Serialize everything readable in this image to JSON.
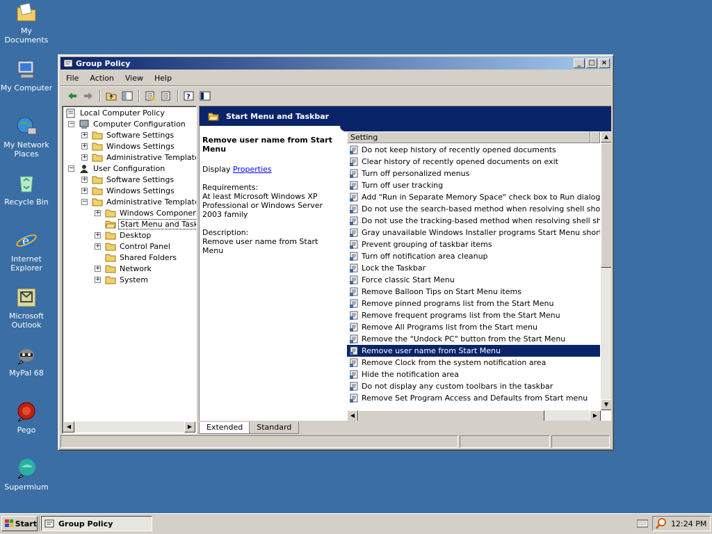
{
  "desktop": {
    "icons": [
      {
        "label": "My Documents"
      },
      {
        "label": "My Computer"
      },
      {
        "label": "My Network Places"
      },
      {
        "label": "Recycle Bin"
      },
      {
        "label": "Internet Explorer"
      },
      {
        "label": "Microsoft Outlook"
      },
      {
        "label": "MyPal 68"
      },
      {
        "label": "Pego"
      },
      {
        "label": "Supermium"
      }
    ]
  },
  "window": {
    "title": "Group Policy",
    "controls": {
      "minimize": "_",
      "maximize": "□",
      "close": "×"
    },
    "menu": [
      "File",
      "Action",
      "View",
      "Help"
    ],
    "statusbar": [
      "",
      "",
      ""
    ]
  },
  "tree": {
    "root": "Local Computer Policy",
    "computer_config": "Computer Configuration",
    "cc_software": "Software Settings",
    "cc_windows": "Windows Settings",
    "cc_admin": "Administrative Templates",
    "user_config": "User Configuration",
    "uc_software": "Software Settings",
    "uc_windows": "Windows Settings",
    "uc_admin": "Administrative Templates",
    "windows_components": "Windows Components",
    "start_menu": "Start Menu and Taskba",
    "desktop": "Desktop",
    "control_panel": "Control Panel",
    "shared_folders": "Shared Folders",
    "network": "Network",
    "system": "System"
  },
  "details": {
    "header": "Start Menu and Taskbar",
    "policy_title": "Remove user name from Start Menu",
    "display_label": "Display",
    "properties_link": "Properties",
    "requirements_label": "Requirements:",
    "requirements_text": "At least Microsoft Windows XP Professional or Windows Server 2003 family",
    "description_label": "Description:",
    "description_text": "Remove user name from Start Menu"
  },
  "list": {
    "column": "Setting",
    "selected_index": 17,
    "rows": [
      "Do not keep history of recently opened documents",
      "Clear history of recently opened documents on exit",
      "Turn off personalized menus",
      "Turn off user tracking",
      "Add \"Run in Separate Memory Space\" check box to Run dialog box",
      "Do not use the search-based method when resolving shell shortcuts",
      "Do not use the tracking-based method when resolving shell short…",
      "Gray unavailable Windows Installer programs Start Menu shortcuts",
      "Prevent grouping of taskbar items",
      "Turn off notification area cleanup",
      "Lock the Taskbar",
      "Force classic Start Menu",
      "Remove Balloon Tips on Start Menu items",
      "Remove pinned programs list from the Start Menu",
      "Remove frequent programs list from the Start Menu",
      "Remove All Programs list from the Start menu",
      "Remove the \"Undock PC\" button from the Start Menu",
      "Remove user name from Start Menu",
      "Remove Clock from the system notification area",
      "Hide the notification area",
      "Do not display any custom toolbars in the taskbar",
      "Remove Set Program Access and Defaults from Start menu"
    ]
  },
  "tabs": {
    "extended": "Extended",
    "standard": "Standard"
  },
  "taskbar": {
    "start": "Start",
    "task": "Group Policy",
    "clock": "12:24 PM"
  },
  "colors": {
    "desktop": "#3a6ea5",
    "selection": "#0a246a",
    "link": "#0000ff"
  }
}
